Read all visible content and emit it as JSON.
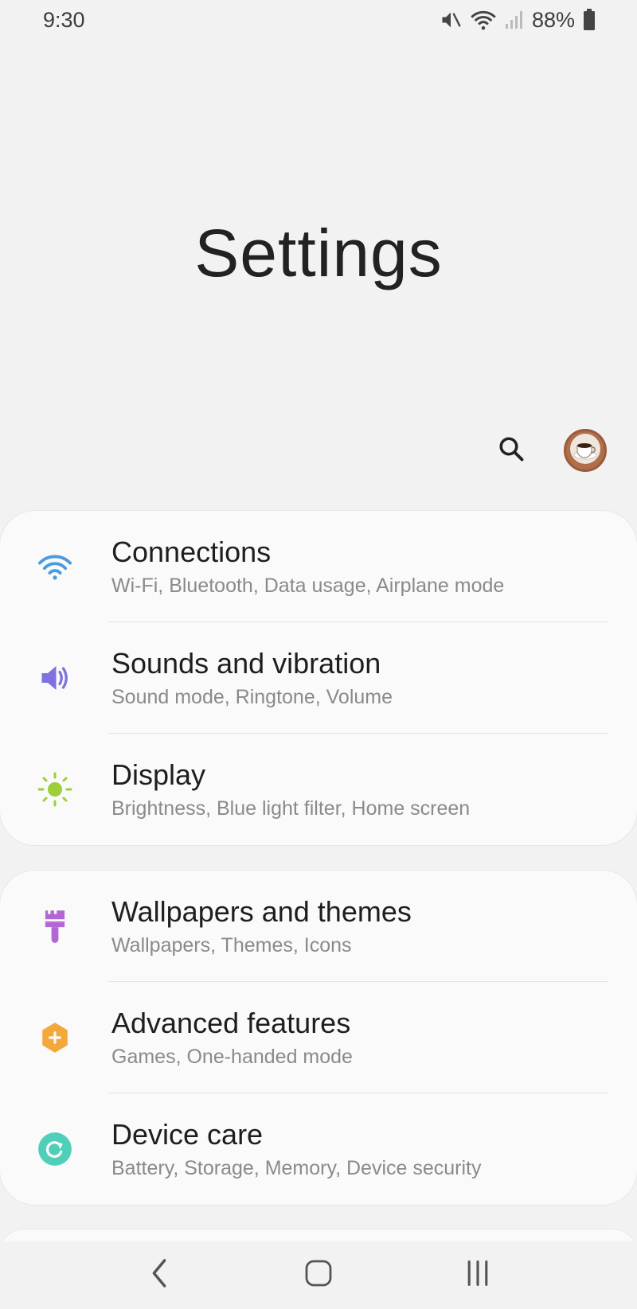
{
  "status_bar": {
    "time": "9:30",
    "battery_text": "88%",
    "icons": [
      "mute-icon",
      "wifi-icon",
      "signal-icon",
      "battery-icon"
    ]
  },
  "page": {
    "title": "Settings"
  },
  "header_actions": {
    "search_icon": "search-icon",
    "avatar_icon": "coffee-cup-avatar"
  },
  "settings": {
    "group1": [
      {
        "icon": "wifi-icon",
        "title": "Connections",
        "subtitle": "Wi-Fi, Bluetooth, Data usage, Airplane mode"
      },
      {
        "icon": "speaker-icon",
        "title": "Sounds and vibration",
        "subtitle": "Sound mode, Ringtone, Volume"
      },
      {
        "icon": "sun-icon",
        "title": "Display",
        "subtitle": "Brightness, Blue light filter, Home screen"
      }
    ],
    "group2": [
      {
        "icon": "paintbrush-icon",
        "title": "Wallpapers and themes",
        "subtitle": "Wallpapers, Themes, Icons"
      },
      {
        "icon": "gear-plus-icon",
        "title": "Advanced features",
        "subtitle": "Games, One-handed mode"
      },
      {
        "icon": "device-care-icon",
        "title": "Device care",
        "subtitle": "Battery, Storage, Memory, Device security"
      }
    ]
  },
  "nav_bar": {
    "buttons": [
      "back-icon",
      "home-icon",
      "recents-icon"
    ]
  },
  "colors": {
    "wifi": "#4a9be0",
    "sound": "#7d72e0",
    "display": "#9ccf3a",
    "wallpaper": "#b366d6",
    "advanced": "#f3a83b",
    "device_care": "#4fcfba"
  }
}
